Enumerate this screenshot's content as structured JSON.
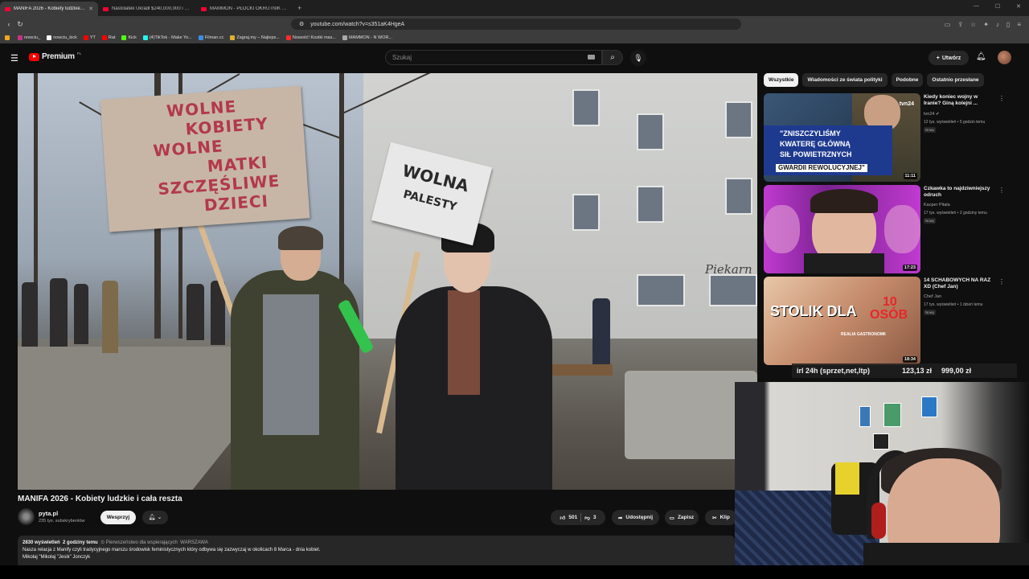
{
  "browser": {
    "tabs": [
      {
        "title": "MANIFA 2026 - Kobiety ludzkie i cała reszta",
        "active": true
      },
      {
        "title": "Nastolatek Ukradł $240,000,000 i Po...",
        "active": false
      },
      {
        "title": "MAMMON - PŁOCKI OKRUTNIK PUB...",
        "active": false
      }
    ],
    "url": "youtube.com/watch?v=s351aK4HgeA",
    "bookmarks": [
      {
        "label": "",
        "color": "#f4a623"
      },
      {
        "label": "nowciu_",
        "color": "#c13584"
      },
      {
        "label": "nowciu_kick",
        "color": "#ffffff"
      },
      {
        "label": "YT",
        "color": "#ff0000"
      },
      {
        "label": "Rat",
        "color": "#ff0000"
      },
      {
        "label": "Kick",
        "color": "#53fc18"
      },
      {
        "label": "(4)TikTok - Make Yo...",
        "color": "#25f4ee"
      },
      {
        "label": "Filman.cc",
        "color": "#3a8ee6"
      },
      {
        "label": "Zagraj.my – Najleps...",
        "color": "#e0b030"
      },
      {
        "label": "Nowość! Kostki mas...",
        "color": "#ff2a2a"
      },
      {
        "label": "MAMMON - N WOR...",
        "color": "#aaaaaa"
      }
    ]
  },
  "youtube": {
    "logo": "Premium",
    "logo_region": "PL",
    "search_placeholder": "Szukaj",
    "create_label": "Utwórz"
  },
  "video": {
    "title": "MANIFA 2026 - Kobiety ludzkie i cała reszta",
    "sign1": [
      "WOLNE",
      "KOBIETY",
      "WOLNE",
      "MATKI",
      "SZCZĘŚLIWE",
      "DZIECI"
    ],
    "sign2": [
      "WOLNA",
      "PALESTY"
    ],
    "shop_sign": "Piekarn",
    "channel": "pyta.pl",
    "subscribers": "235 tys. subskrybentów",
    "support_label": "Wesprzyj",
    "likes": "501",
    "dislikes": "3",
    "share_label": "Udostępnij",
    "save_label": "Zapisz",
    "clip_label": "Klip",
    "views": "2830 wyświetleń",
    "age": "2 godziny temu",
    "priority_tag": "Pierwszeństwo dla wspierających",
    "location_tag": "WARSZAWA",
    "description_line1": "Nasza relacja z Manify czyli tradycyjnego marszu środowisk feministycznych który odbywa się zazwyczaj w okolicach 8 Marca - dnia kobiet.",
    "description_line2": "Mikołaj \"Mikołaj \"Jesik\" Jonczyk"
  },
  "sidebar": {
    "chips": [
      "Wszystkie",
      "Wiadomości ze świata polityki",
      "Podobne",
      "Ostatnio przesłane"
    ],
    "recommendations": [
      {
        "title": "Kiedy koniec wojny w Iranie? Giną kolejni ...",
        "channel": "tvn24",
        "views": "12 tys. wyświetleń • 5 godzin temu",
        "badge": "Nowy",
        "duration": "11:11",
        "thumb_text": [
          "\"ZNISZCZYLIŚMY",
          "KWATERĘ GŁÓWNĄ",
          "SIŁ POWIETRZNYCH",
          "GWARDII REWOLUCYJNEJ\""
        ],
        "thumb_logo": "tvn24"
      },
      {
        "title": "Czkawka to najdziwniejszy odruch",
        "channel": "Kacper Pitala",
        "views": "17 tys. wyświetleń • 2 godziny temu",
        "badge": "Nowy",
        "duration": "17:23"
      },
      {
        "title": "14 SCHABOWYCH NA RAZ XD (Chef Jan)",
        "channel": "Chef Jan",
        "views": "17 tys. wyświetleń • 1 dzień temu",
        "badge": "Nowy",
        "duration": "18:34",
        "thumb_text": [
          "STOLIK DLA",
          "10",
          "OSÓB",
          "REALIA GASTRONOMII"
        ]
      }
    ]
  },
  "overlay": {
    "ticker_a": "irl 24h (sprzet,net,ltp)",
    "ticker_b": "123,13 zł",
    "ticker_c": "999,00 zł"
  }
}
